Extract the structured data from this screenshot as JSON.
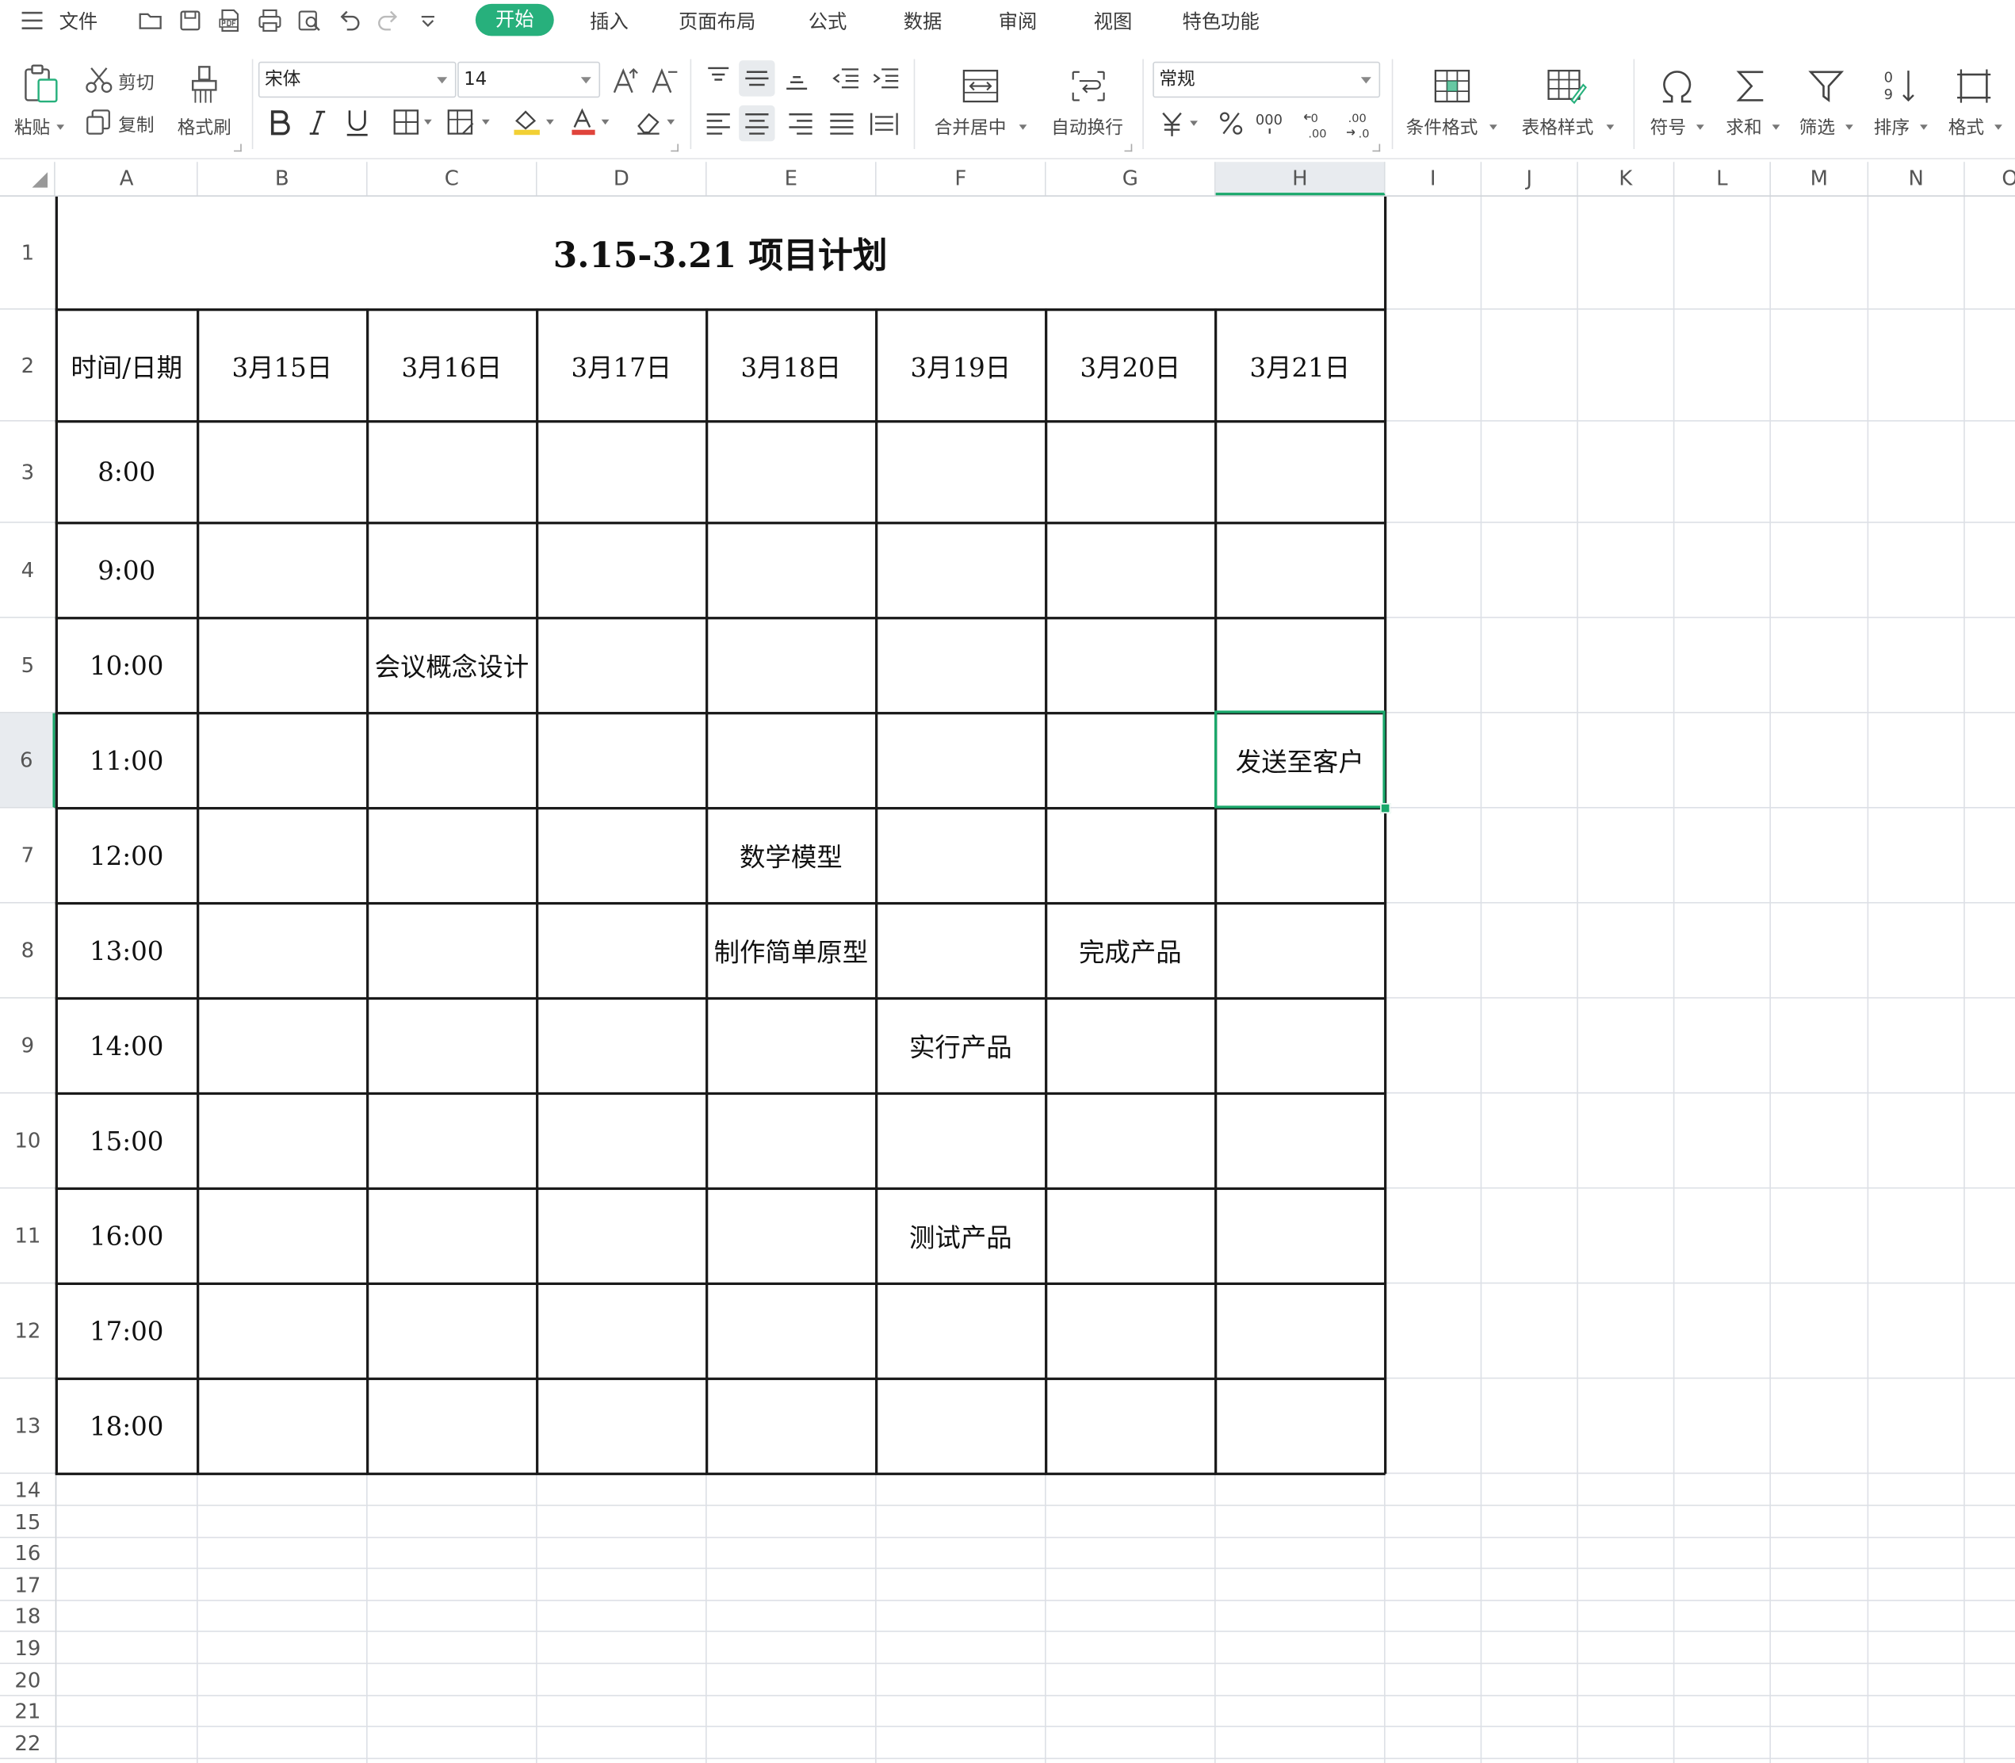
{
  "menubar": {
    "file": "文件",
    "tabs": [
      "开始",
      "插入",
      "页面布局",
      "公式",
      "数据",
      "审阅",
      "视图",
      "特色功能"
    ]
  },
  "ribbon": {
    "paste": "粘贴",
    "cut": "剪切",
    "copy": "复制",
    "format_painter": "格式刷",
    "font_name": "宋体",
    "font_size": "14",
    "merge_center": "合并居中",
    "wrap_text": "自动换行",
    "number_format": "常规",
    "conditional_format": "条件格式",
    "table_style": "表格样式",
    "symbol": "符号",
    "sum": "求和",
    "filter": "筛选",
    "sort": "排序",
    "format": "格式"
  },
  "columns": [
    "A",
    "B",
    "C",
    "D",
    "E",
    "F",
    "G",
    "H",
    "I",
    "J",
    "K",
    "L",
    "M",
    "N",
    "O"
  ],
  "rows": [
    "1",
    "2",
    "3",
    "4",
    "5",
    "6",
    "7",
    "8",
    "9",
    "10",
    "11",
    "12",
    "13",
    "14",
    "15",
    "16",
    "17",
    "18",
    "19",
    "20",
    "21",
    "22"
  ],
  "selected": {
    "column": "H",
    "row": "6"
  },
  "sheet": {
    "title": "3.15-3.21 项目计划",
    "header_corner": "时间/日期",
    "dates": [
      "3月15日",
      "3月16日",
      "3月17日",
      "3月18日",
      "3月19日",
      "3月20日",
      "3月21日"
    ],
    "times": [
      "8:00",
      "9:00",
      "10:00",
      "11:00",
      "12:00",
      "13:00",
      "14:00",
      "15:00",
      "16:00",
      "17:00",
      "18:00"
    ],
    "entries": {
      "c5": "会议概念设计",
      "h6": "发送至客户",
      "e7": "数学模型",
      "e8": "制作简单原型",
      "g8": "完成产品",
      "f9": "实行产品",
      "f11": "测试产品"
    }
  },
  "colors": {
    "accent": "#27b07c",
    "selection": "#1aa86b",
    "grid": "#dde0e6",
    "table_border": "#1a1a1a"
  }
}
